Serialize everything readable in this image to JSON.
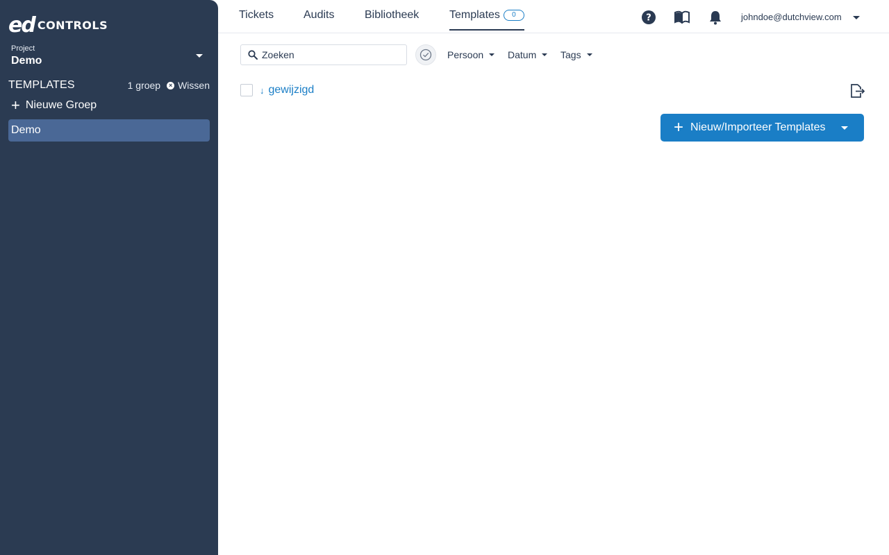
{
  "sidebar": {
    "logo": {
      "mark": "ed",
      "text": "CONTROLS"
    },
    "project": {
      "label": "Project",
      "name": "Demo"
    },
    "templates": {
      "title": "TEMPLATES",
      "group_count": "1 groep",
      "clear_label": "Wissen",
      "new_group_label": "Nieuwe Groep",
      "groups": [
        {
          "label": "Demo",
          "selected": true
        }
      ]
    }
  },
  "topnav": {
    "tabs": [
      {
        "label": "Tickets"
      },
      {
        "label": "Audits"
      },
      {
        "label": "Bibliotheek"
      },
      {
        "label": "Templates",
        "active": true,
        "badge": "0"
      }
    ],
    "icons": [
      "help-icon",
      "book-icon",
      "bell-icon"
    ],
    "user": {
      "email": "johndoe@dutchview.com"
    }
  },
  "toolbar": {
    "search": {
      "placeholder": "Zoeken",
      "value": ""
    },
    "filters": [
      {
        "label": "Persoon"
      },
      {
        "label": "Datum"
      },
      {
        "label": "Tags"
      }
    ],
    "sort": {
      "label": "gewijzigd",
      "direction": "descending"
    },
    "primary_button": {
      "label": "Nieuw/Importeer Templates"
    }
  },
  "colors": {
    "sidebar_bg": "#2b3b52",
    "selected_group_bg": "#4a6896",
    "accent": "#1a7ec6",
    "text_dark": "#2a3a52"
  }
}
